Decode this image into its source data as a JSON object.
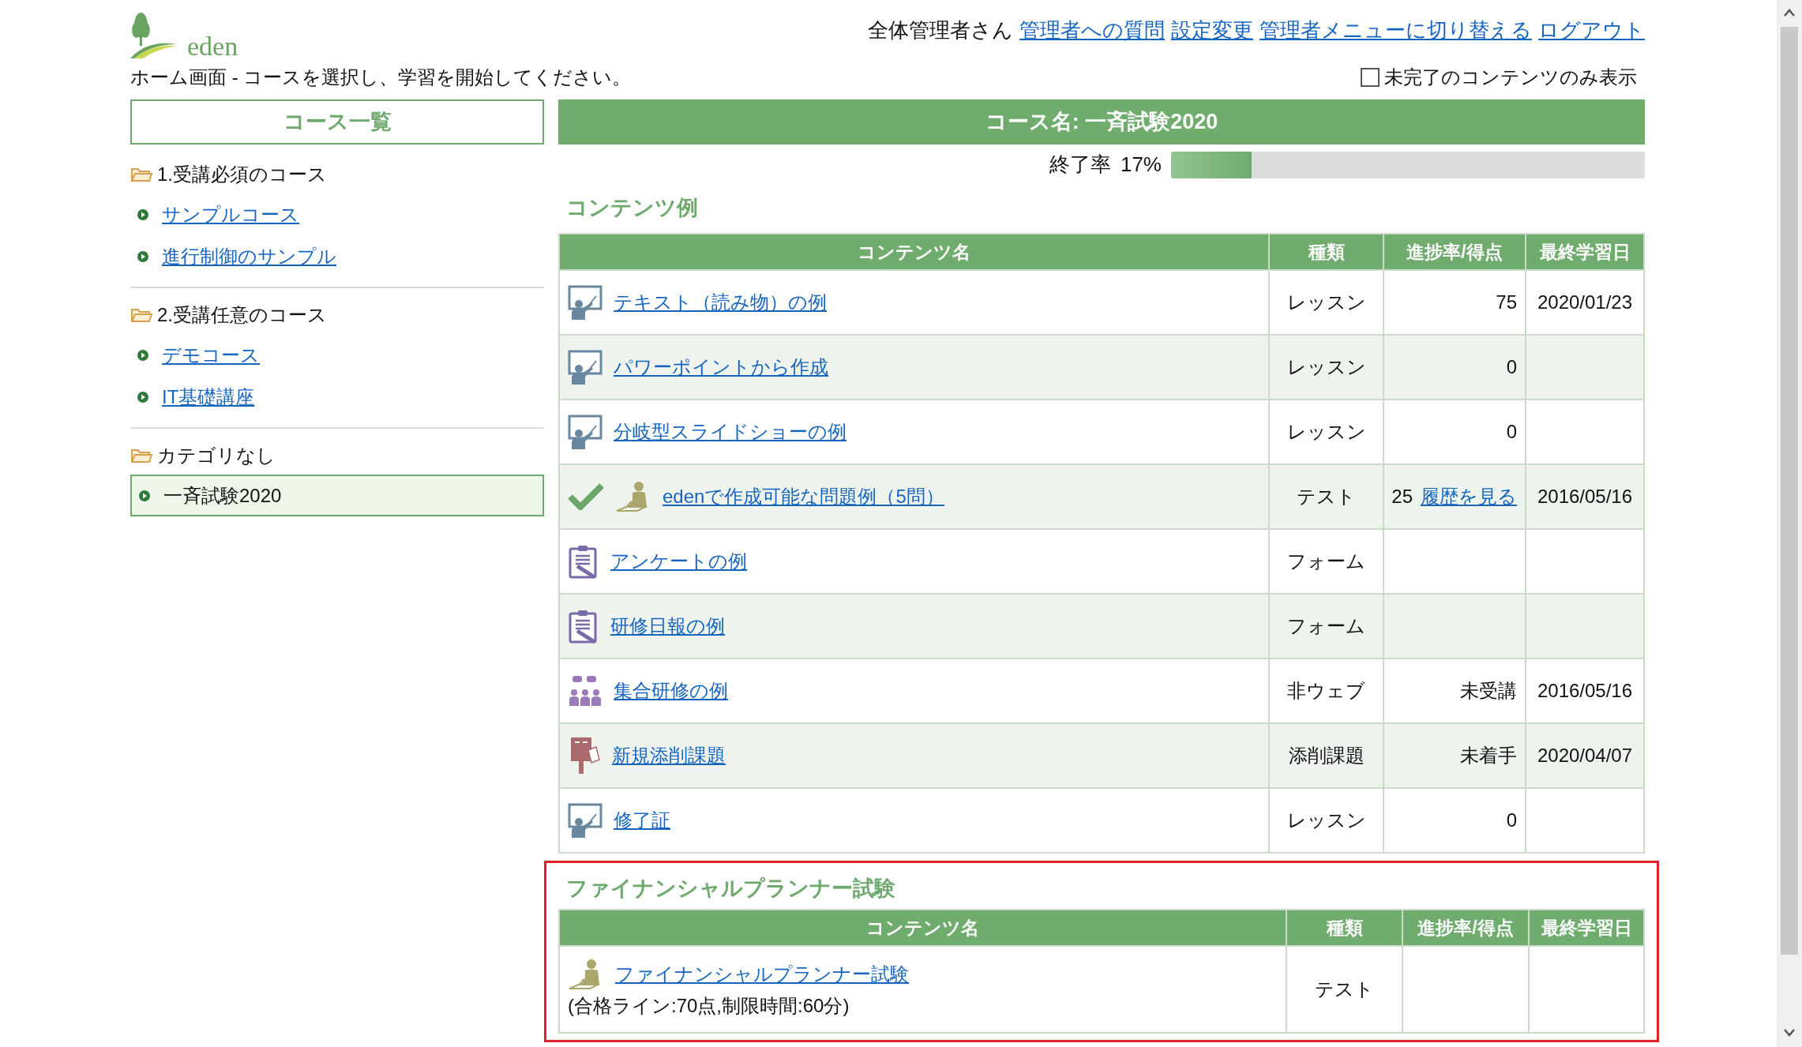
{
  "logo_text": "eden",
  "header": {
    "user_label": "全体管理者さん",
    "links": [
      "管理者への質問",
      "設定変更",
      "管理者メニューに切り替える",
      "ログアウト"
    ]
  },
  "subtitle": "ホーム画面 - コースを選択し、学習を開始してください。",
  "filter_checkbox": {
    "label": "未完了のコンテンツのみ表示",
    "checked": false
  },
  "sidebar": {
    "title": "コース一覧",
    "groups": [
      {
        "name": "1.受講必須のコース",
        "items": [
          {
            "label": "サンプルコース",
            "selected": false
          },
          {
            "label": "進行制御のサンプル",
            "selected": false
          }
        ]
      },
      {
        "name": "2.受講任意のコース",
        "items": [
          {
            "label": "デモコース",
            "selected": false
          },
          {
            "label": "IT基礎講座",
            "selected": false
          }
        ]
      },
      {
        "name": "カテゴリなし",
        "items": [
          {
            "label": "一斉試験2020",
            "selected": true
          }
        ]
      }
    ]
  },
  "course_banner": "コース名: 一斉試験2020",
  "progress": {
    "label": "終了率",
    "value": "17%",
    "level": 0.17
  },
  "sections": [
    {
      "title": "コンテンツ例",
      "highlighted": false,
      "columns": [
        "コンテンツ名",
        "種類",
        "進捗率/得点",
        "最終学習日"
      ],
      "rows": [
        {
          "kind": "lesson",
          "completed": false,
          "name": "テキスト（読み物）の例",
          "type": "レッスン",
          "progress": "75",
          "date": "2020/01/23"
        },
        {
          "kind": "lesson",
          "completed": false,
          "name": "パワーポイントから作成",
          "type": "レッスン",
          "progress": "0"
        },
        {
          "kind": "lesson",
          "completed": false,
          "name": "分岐型スライドショーの例",
          "type": "レッスン",
          "progress": "0"
        },
        {
          "kind": "test",
          "completed": true,
          "name": "edenで作成可能な問題例（5問）",
          "type": "テスト",
          "progress": "25",
          "progress_link": "履歴を見る",
          "date": "2016/05/16"
        },
        {
          "kind": "form",
          "completed": false,
          "name": "アンケートの例",
          "type": "フォーム"
        },
        {
          "kind": "form",
          "completed": false,
          "name": "研修日報の例",
          "type": "フォーム"
        },
        {
          "kind": "offline",
          "completed": false,
          "name": "集合研修の例",
          "type": "非ウェブ",
          "progress": "未受講",
          "date": "2016/05/16"
        },
        {
          "kind": "report",
          "completed": false,
          "name": "新規添削課題",
          "type": "添削課題",
          "progress": "未着手",
          "date": "2020/04/07"
        },
        {
          "kind": "lesson",
          "completed": false,
          "name": "修了証",
          "type": "レッスン",
          "progress": "0"
        }
      ]
    },
    {
      "title": "ファイナンシャルプランナー試験",
      "highlighted": true,
      "columns": [
        "コンテンツ名",
        "種類",
        "進捗率/得点",
        "最終学習日"
      ],
      "rows": [
        {
          "kind": "test",
          "completed": false,
          "name": "ファイナンシャルプランナー試験",
          "note": "(合格ライン:70点,制限時間:60分)",
          "type": "テスト"
        }
      ]
    }
  ]
}
